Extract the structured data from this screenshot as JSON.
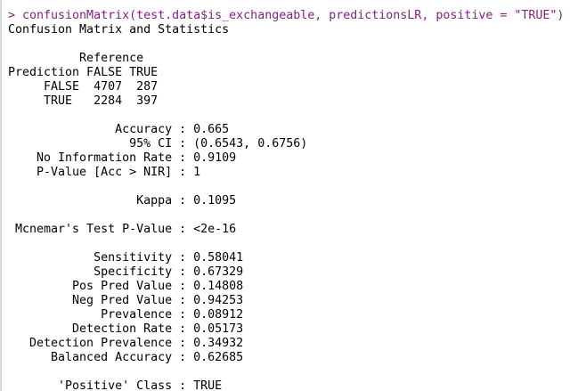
{
  "console": {
    "colors": {
      "command": "#8a1d8a",
      "output": "#000000",
      "background": "#ffffff"
    },
    "lines": [
      {
        "text": "",
        "kind": "output"
      },
      {
        "text": "> confusionMatrix(test.data$is_exchangeable, predictionsLR, positive = \"TRUE\")",
        "kind": "command"
      },
      {
        "text": "Confusion Matrix and Statistics",
        "kind": "output"
      },
      {
        "text": "",
        "kind": "output"
      },
      {
        "text": "          Reference",
        "kind": "output"
      },
      {
        "text": "Prediction FALSE TRUE",
        "kind": "output"
      },
      {
        "text": "     FALSE  4707  287",
        "kind": "output"
      },
      {
        "text": "     TRUE   2284  397",
        "kind": "output"
      },
      {
        "text": "",
        "kind": "output"
      },
      {
        "text": "               Accuracy : 0.665",
        "kind": "output"
      },
      {
        "text": "                 95% CI : (0.6543, 0.6756)",
        "kind": "output"
      },
      {
        "text": "    No Information Rate : 0.9109",
        "kind": "output"
      },
      {
        "text": "    P-Value [Acc > NIR] : 1",
        "kind": "output"
      },
      {
        "text": "",
        "kind": "output"
      },
      {
        "text": "                  Kappa : 0.1095",
        "kind": "output"
      },
      {
        "text": "",
        "kind": "output"
      },
      {
        "text": " Mcnemar's Test P-Value : <2e-16",
        "kind": "output"
      },
      {
        "text": "",
        "kind": "output"
      },
      {
        "text": "            Sensitivity : 0.58041",
        "kind": "output"
      },
      {
        "text": "            Specificity : 0.67329",
        "kind": "output"
      },
      {
        "text": "         Pos Pred Value : 0.14808",
        "kind": "output"
      },
      {
        "text": "         Neg Pred Value : 0.94253",
        "kind": "output"
      },
      {
        "text": "             Prevalence : 0.08912",
        "kind": "output"
      },
      {
        "text": "         Detection Rate : 0.05173",
        "kind": "output"
      },
      {
        "text": "   Detection Prevalence : 0.34932",
        "kind": "output"
      },
      {
        "text": "      Balanced Accuracy : 0.62685",
        "kind": "output"
      },
      {
        "text": "",
        "kind": "output"
      },
      {
        "text": "       'Positive' Class : TRUE",
        "kind": "output"
      }
    ]
  }
}
